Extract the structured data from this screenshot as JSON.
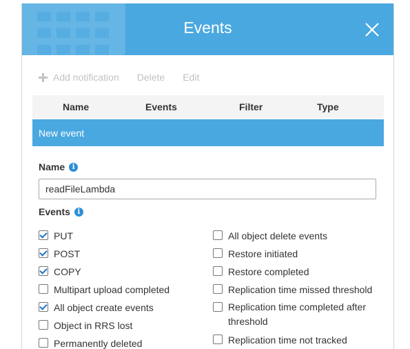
{
  "header": {
    "title": "Events",
    "close_icon": "close-icon",
    "background_icon": "calendar-icon",
    "color": "#4aa8e0"
  },
  "toolbar": {
    "add_label": "Add notification",
    "delete_label": "Delete",
    "edit_label": "Edit"
  },
  "table": {
    "columns": [
      "Name",
      "Events",
      "Filter",
      "Type"
    ]
  },
  "new_event": {
    "label": "New event"
  },
  "form": {
    "name_label": "Name",
    "name_value": "readFileLambda",
    "events_label": "Events"
  },
  "events_left": [
    {
      "label": "PUT",
      "checked": true
    },
    {
      "label": "POST",
      "checked": true
    },
    {
      "label": "COPY",
      "checked": true
    },
    {
      "label": "Multipart upload completed",
      "checked": false
    },
    {
      "label": "All object create events",
      "checked": true
    },
    {
      "label": "Object in RRS lost",
      "checked": false
    },
    {
      "label": "Permanently deleted",
      "checked": false
    }
  ],
  "events_right": [
    {
      "label": "All object delete events",
      "checked": false
    },
    {
      "label": "Restore initiated",
      "checked": false
    },
    {
      "label": "Restore completed",
      "checked": false
    },
    {
      "label": "Replication time missed threshold",
      "checked": false
    },
    {
      "label": "Replication time completed after threshold",
      "checked": false
    },
    {
      "label": "Replication time not tracked",
      "checked": false
    }
  ]
}
